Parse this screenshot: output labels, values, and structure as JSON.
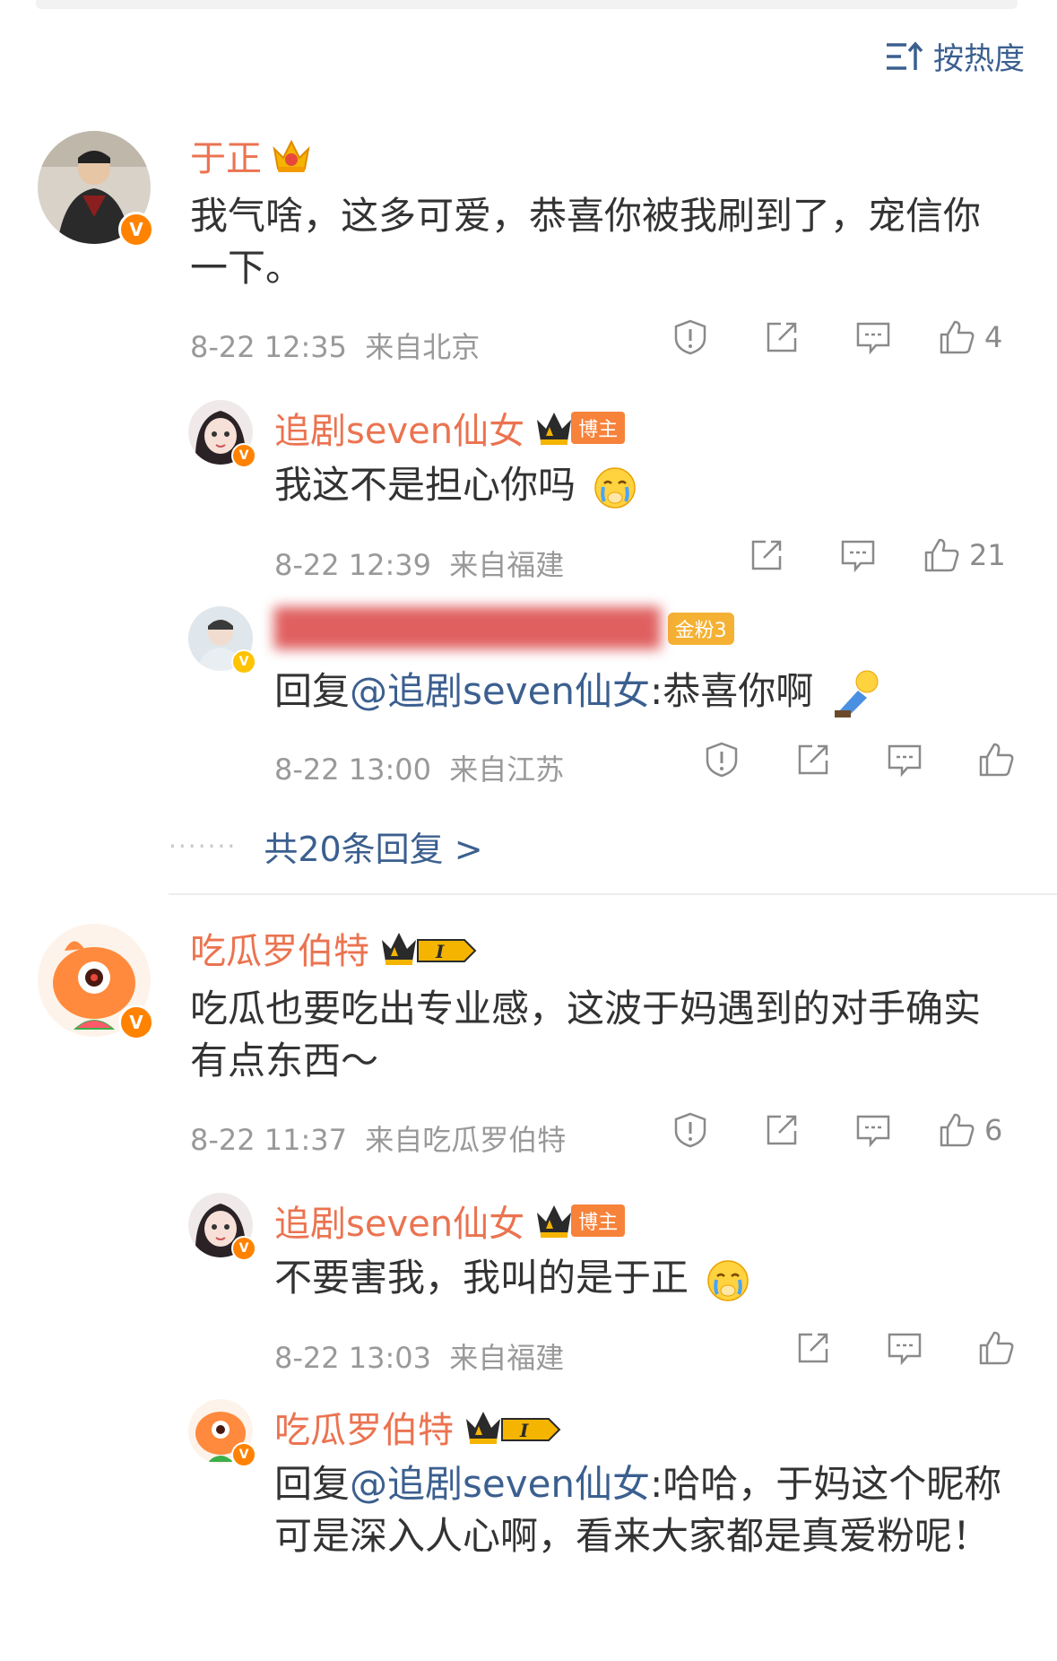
{
  "sort": {
    "label": "按热度"
  },
  "comments": [
    {
      "name": "于正",
      "text": "我气啥，这多可爱，恭喜你被我刷到了，宠信你一下。",
      "time": "8-22 12:35",
      "location": "来自北京",
      "likes": "4",
      "replies": [
        {
          "name": "追剧seven仙女",
          "badge": "博主",
          "text": "我这不是担心你吗",
          "time": "8-22 12:39",
          "location": "来自福建",
          "likes": "21"
        },
        {
          "name": "",
          "badge": "金粉3",
          "reply_prefix": "回复",
          "mention": "@追剧seven仙女",
          "text": ":恭喜你啊",
          "time": "8-22 13:00",
          "location": "来自江苏",
          "likes": ""
        }
      ],
      "more_replies": "共20条回复 >"
    },
    {
      "name": "吃瓜罗伯特",
      "text": "吃瓜也要吃出专业感，这波于妈遇到的对手确实有点东西～",
      "time": "8-22 11:37",
      "location": "来自吃瓜罗伯特",
      "likes": "6",
      "replies": [
        {
          "name": "追剧seven仙女",
          "badge": "博主",
          "text": "不要害我，我叫的是于正",
          "time": "8-22 13:03",
          "location": "来自福建",
          "likes": ""
        },
        {
          "name": "吃瓜罗伯特",
          "reply_prefix": "回复",
          "mention": "@追剧seven仙女",
          "text": ":哈哈，于妈这个昵称可是深入人心啊，看来大家都是真爱粉呢！"
        }
      ]
    }
  ],
  "colors": {
    "name": "#eb7350",
    "link": "#3b5f8f",
    "meta": "#999999",
    "vbadge": "#ff8200"
  }
}
